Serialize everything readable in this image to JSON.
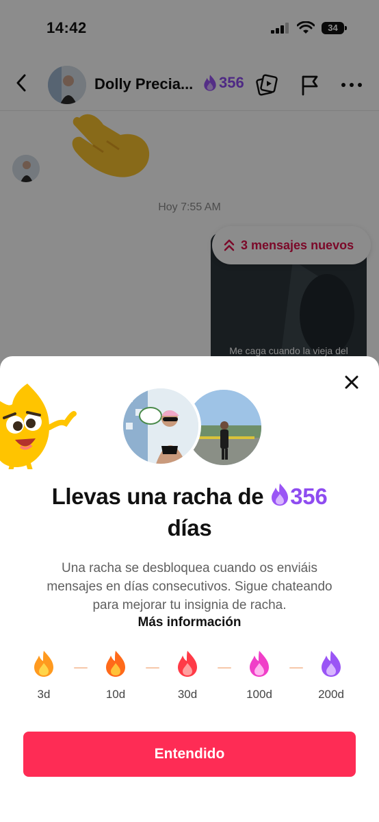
{
  "status_bar": {
    "time": "14:42",
    "battery": "34"
  },
  "chat_header": {
    "name": "Dolly Precia...",
    "streak_count": "356"
  },
  "chat": {
    "timestamp": "Hoy 7:55 AM",
    "new_messages": "3 mensajes nuevos",
    "video_caption": "Me caga cuando la vieja del"
  },
  "sheet": {
    "title_prefix": "Llevas una racha de ",
    "streak_count": "356",
    "title_suffix": "días",
    "description": "Una racha se desbloquea cuando os enviáis mensajes en días consecutivos. Sigue chateando para mejorar tu insignia de racha.",
    "more_info": "Más información",
    "milestones": [
      {
        "label": "3d",
        "color": "#ff9a1f",
        "inner": "#ffd54a"
      },
      {
        "label": "10d",
        "color": "#ff6a1a",
        "inner": "#ffc23a"
      },
      {
        "label": "30d",
        "color": "#ff3b47",
        "inner": "#ff9f9f"
      },
      {
        "label": "100d",
        "color": "#f03fc8",
        "inner": "#ffb3ef"
      },
      {
        "label": "200d",
        "color": "#9a55f5",
        "inner": "#d8b6ff"
      }
    ],
    "button": "Entendido"
  },
  "colors": {
    "accent": "#fe2c55",
    "streak_purple": "#8e4cf0"
  }
}
